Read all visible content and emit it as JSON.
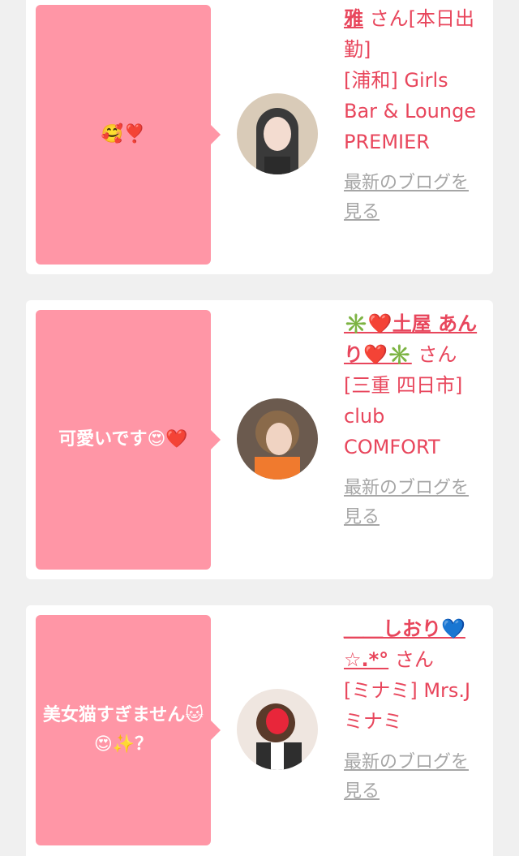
{
  "cards": [
    {
      "comment": "🥰❣️",
      "name": "雅",
      "suffix": "さん[本日出勤]",
      "shop": "[浦和] Girls Bar & Lounge PREMIER",
      "blog_link": "最新のブログを見る"
    },
    {
      "comment": "可愛いです😍❤️",
      "name": "✳️❤️土屋 あんり❤️✳️",
      "suffix": "さん",
      "shop": "[三重 四日市] club COMFORT",
      "blog_link": "最新のブログを見る"
    },
    {
      "comment": "美女猫すぎません🐱😍✨？",
      "name": "＿＿しおり💙☆.*°",
      "suffix": "さん",
      "shop": "[ミナミ] Mrs.J ミナミ",
      "blog_link": "最新のブログを見る"
    }
  ],
  "colors": {
    "bubble": "#ff96a6",
    "accent": "#e8465c",
    "link_gray": "#a6a6a6",
    "background": "#f0f0f0"
  }
}
